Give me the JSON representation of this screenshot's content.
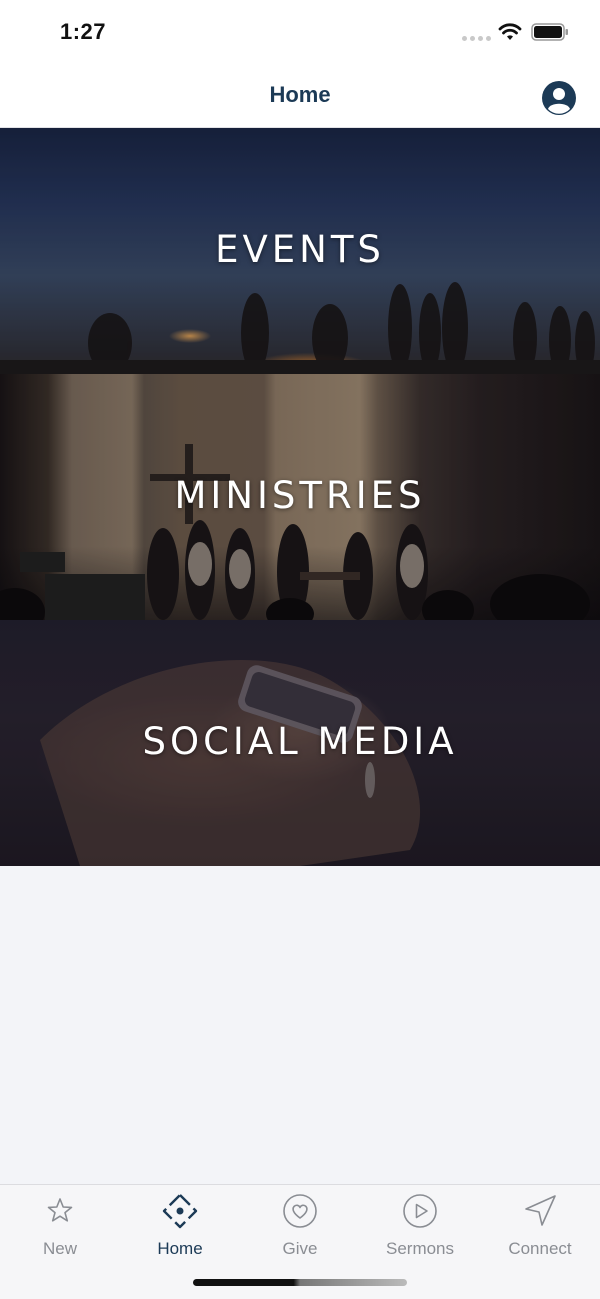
{
  "status_bar": {
    "time": "1:27"
  },
  "nav": {
    "title": "Home"
  },
  "tiles": [
    {
      "label": "EVENTS"
    },
    {
      "label": "MINISTRIES"
    },
    {
      "label": "SOCIAL MEDIA"
    }
  ],
  "tabs": [
    {
      "label": "New",
      "icon": "star-icon"
    },
    {
      "label": "Home",
      "icon": "home-diamond-icon",
      "active": true
    },
    {
      "label": "Give",
      "icon": "heart-circle-icon"
    },
    {
      "label": "Sermons",
      "icon": "play-circle-icon"
    },
    {
      "label": "Connect",
      "icon": "location-arrow-icon"
    }
  ],
  "colors": {
    "accent": "#1c3a56",
    "inactive_tab": "#8a8d93",
    "background": "#f3f4f8"
  }
}
